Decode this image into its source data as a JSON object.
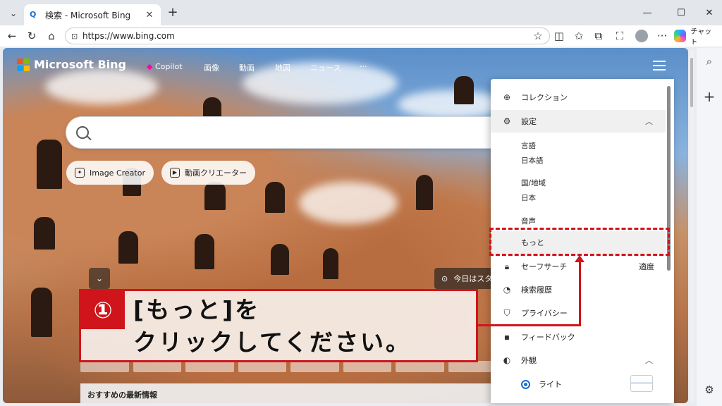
{
  "browser": {
    "tab_title": "検索 - Microsoft Bing",
    "tab_favicon": "bing-search-icon",
    "url": "https://www.bing.com",
    "chat_label": "チャット"
  },
  "bing": {
    "logo_text": "Microsoft Bing",
    "nav": [
      "Copilot",
      "画像",
      "動画",
      "地図",
      "ニュース",
      "···"
    ],
    "image_creator_label": "Image Creator",
    "video_creator_label": "動画クリエーター",
    "location_text": "今日はスタ",
    "bottom_card_title": "おすすめの最新情報"
  },
  "menu": {
    "collections": "コレクション",
    "settings": "設定",
    "language_label": "言語",
    "language_value": "日本語",
    "region_label": "国/地域",
    "region_value": "日本",
    "voice_label": "音声",
    "more_label": "もっと",
    "safesearch_label": "セーフサーチ",
    "safesearch_value": "適度",
    "history_label": "検索履歴",
    "privacy_label": "プライバシー",
    "feedback_label": "フィードバック",
    "appearance_label": "外観",
    "light_label": "ライト"
  },
  "annotation": {
    "number": "①",
    "text": "[もっと]を\nクリックしてください。",
    "color": "#d0141b"
  }
}
